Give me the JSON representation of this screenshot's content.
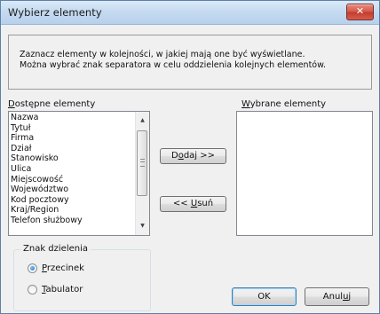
{
  "window": {
    "title": "Wybierz elementy",
    "close_label": "✕"
  },
  "info": {
    "line1": "Zaznacz elementy w kolejności, w jakiej mają one być wyświetlane.",
    "line2": "Można wybrać znak separatora w celu oddzielenia kolejnych elementów."
  },
  "available": {
    "label_first": "D",
    "label_rest": "ostępne elementy",
    "items": [
      "Nazwa",
      "Tytuł",
      "Firma",
      "Dział",
      "Stanowisko",
      "Ulica",
      "Miejscowość",
      "Województwo",
      "Kod pocztowy",
      "Kraj/Region",
      "Telefon służbowy"
    ],
    "scroll_up_icon": "up-arrow-icon",
    "scroll_down_icon": "down-arrow-icon"
  },
  "selected": {
    "label_first": "W",
    "label_rest": "ybrane elementy",
    "items": []
  },
  "buttons": {
    "add_pre": "D",
    "add_u": "o",
    "add_post": "daj >>",
    "remove_pre": "<< ",
    "remove_u": "U",
    "remove_post": "suń",
    "ok": "OK",
    "cancel_pre": "Anul",
    "cancel_u": "u",
    "cancel_post": "j"
  },
  "separator": {
    "title": "Znak dzielenia",
    "option1_u": "P",
    "option1_rest": "rzecinek",
    "option2_u": "T",
    "option2_rest": "abulator",
    "selected_option": "Przecinek"
  },
  "colors": {
    "accent_blue": "#3c7fb1",
    "close_red": "#c23b2d"
  }
}
